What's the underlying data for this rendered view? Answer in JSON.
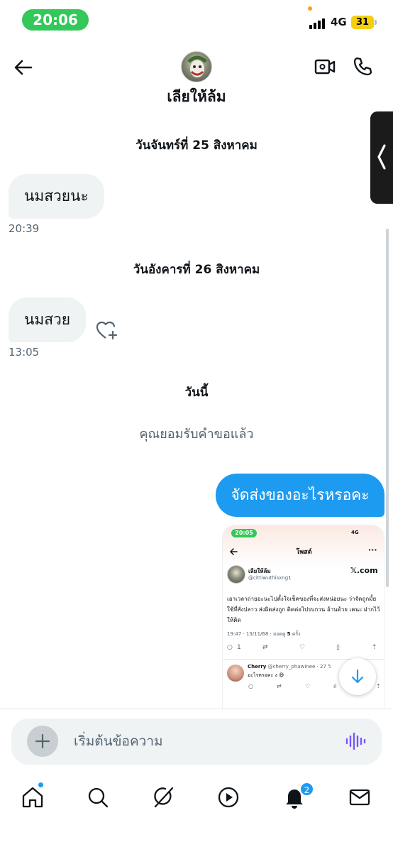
{
  "status_bar": {
    "time": "20:06",
    "network": "4G",
    "battery": "31"
  },
  "header": {
    "contact_name": "เลียให้ล้ม"
  },
  "conversation": {
    "date_1": "วันจันทร์ที่ 25 สิงหาคม",
    "message_1": {
      "text": "นมสวยนะ",
      "time": "20:39"
    },
    "date_2": "วันอังคารที่ 26 สิงหาคม",
    "message_2": {
      "text": "นมสวย",
      "time": "13:05"
    },
    "date_3": "วันนี้",
    "system_note": "คุณยอมรับคำขอแล้ว",
    "outgoing_message": "จัดส่งของอะไรหรอคะ"
  },
  "shared_screenshot": {
    "time": "20:05",
    "status": "4G",
    "title": "โพสต์",
    "author_name": "เลียให้ล้ม",
    "author_handle": "@cittiwuthisxng1",
    "logo": "𝕏.com",
    "body": "เอาเวลาถ่ายอะนะไปตั้งใจเช็คของที่จะส่งหน่อยนะ ว่าจัดถูกมั้ย ใช้ที่สั่งปลาว ส่งผิดส่งถูก ติดต่อไปรบกวน อ้านด้วย เคนะ ฝากไว้ให้คิด",
    "meta_time": "19:47 · 13/11/68 · ยอดดู",
    "meta_views": "5",
    "meta_views_suffix": "ครั้ง",
    "reply_count": "1",
    "reply_name": "Cherry",
    "reply_handle": "@cherry_phawinee · 27 วิ",
    "reply_text": "อะไรหรอคะ ง 😄"
  },
  "composer": {
    "placeholder": "เริ่มต้นข้อความ"
  },
  "bottom_nav": {
    "notification_count": "2"
  },
  "colors": {
    "accent": "#1d9bf0",
    "status_green": "#34c759",
    "incoming_bubble": "#eff3f4",
    "muted_text": "#536471",
    "battery_yellow": "#f5cf0f"
  },
  "icons": [
    "back-arrow-icon",
    "video-call-icon",
    "phone-icon",
    "heart-plus-icon",
    "chevron-left-icon",
    "arrow-down-icon",
    "plus-icon",
    "voice-wave-icon",
    "home-icon",
    "search-icon",
    "grok-icon",
    "play-icon",
    "bell-icon",
    "mail-icon"
  ]
}
